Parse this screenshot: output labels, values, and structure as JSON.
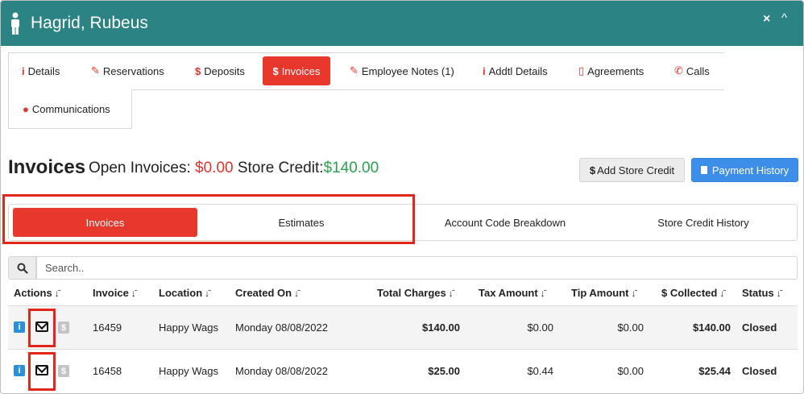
{
  "header": {
    "title": "Hagrid, Rubeus",
    "close": "×",
    "collapse": "^"
  },
  "tabs": [
    {
      "label": "Details",
      "icon": "i"
    },
    {
      "label": "Reservations",
      "icon": "✎"
    },
    {
      "label": "Deposits",
      "icon": "$"
    },
    {
      "label": "Invoices",
      "icon": "$"
    },
    {
      "label": "Employee Notes (1)",
      "icon": "✎"
    },
    {
      "label": "Addtl Details",
      "icon": "i"
    },
    {
      "label": "Agreements",
      "icon": "▯"
    },
    {
      "label": "Calls",
      "icon": "✆"
    },
    {
      "label": "Communications",
      "icon": "●"
    }
  ],
  "summary": {
    "title": "Invoices",
    "open_label": "Open Invoices:",
    "open_value": "$0.00",
    "credit_label": "Store Credit:",
    "credit_value": "$140.00"
  },
  "buttons": {
    "add_credit": "Add Store Credit",
    "add_credit_icon": "$",
    "payment_history": "Payment History"
  },
  "subtabs": [
    "Invoices",
    "Estimates",
    "Account Code Breakdown",
    "Store Credit History"
  ],
  "search": {
    "placeholder": "Search.."
  },
  "table": {
    "columns": [
      "Actions",
      "Invoice",
      "Location",
      "Created On",
      "Total Charges",
      "Tax Amount",
      "Tip Amount",
      "$ Collected",
      "Status"
    ],
    "rows": [
      {
        "invoice": "16459",
        "location": "Happy Wags",
        "created": "Monday 08/08/2022",
        "total": "$140.00",
        "tax": "$0.00",
        "tip": "$0.00",
        "collected": "$140.00",
        "status": "Closed"
      },
      {
        "invoice": "16458",
        "location": "Happy Wags",
        "created": "Monday 08/08/2022",
        "total": "$25.00",
        "tax": "$0.44",
        "tip": "$0.00",
        "collected": "$25.44",
        "status": "Closed"
      }
    ]
  },
  "colors": {
    "header_bg": "#2b8483",
    "accent_red": "#e8372d",
    "info_blue": "#3d8ee8",
    "credit_green": "#2aa14f"
  }
}
